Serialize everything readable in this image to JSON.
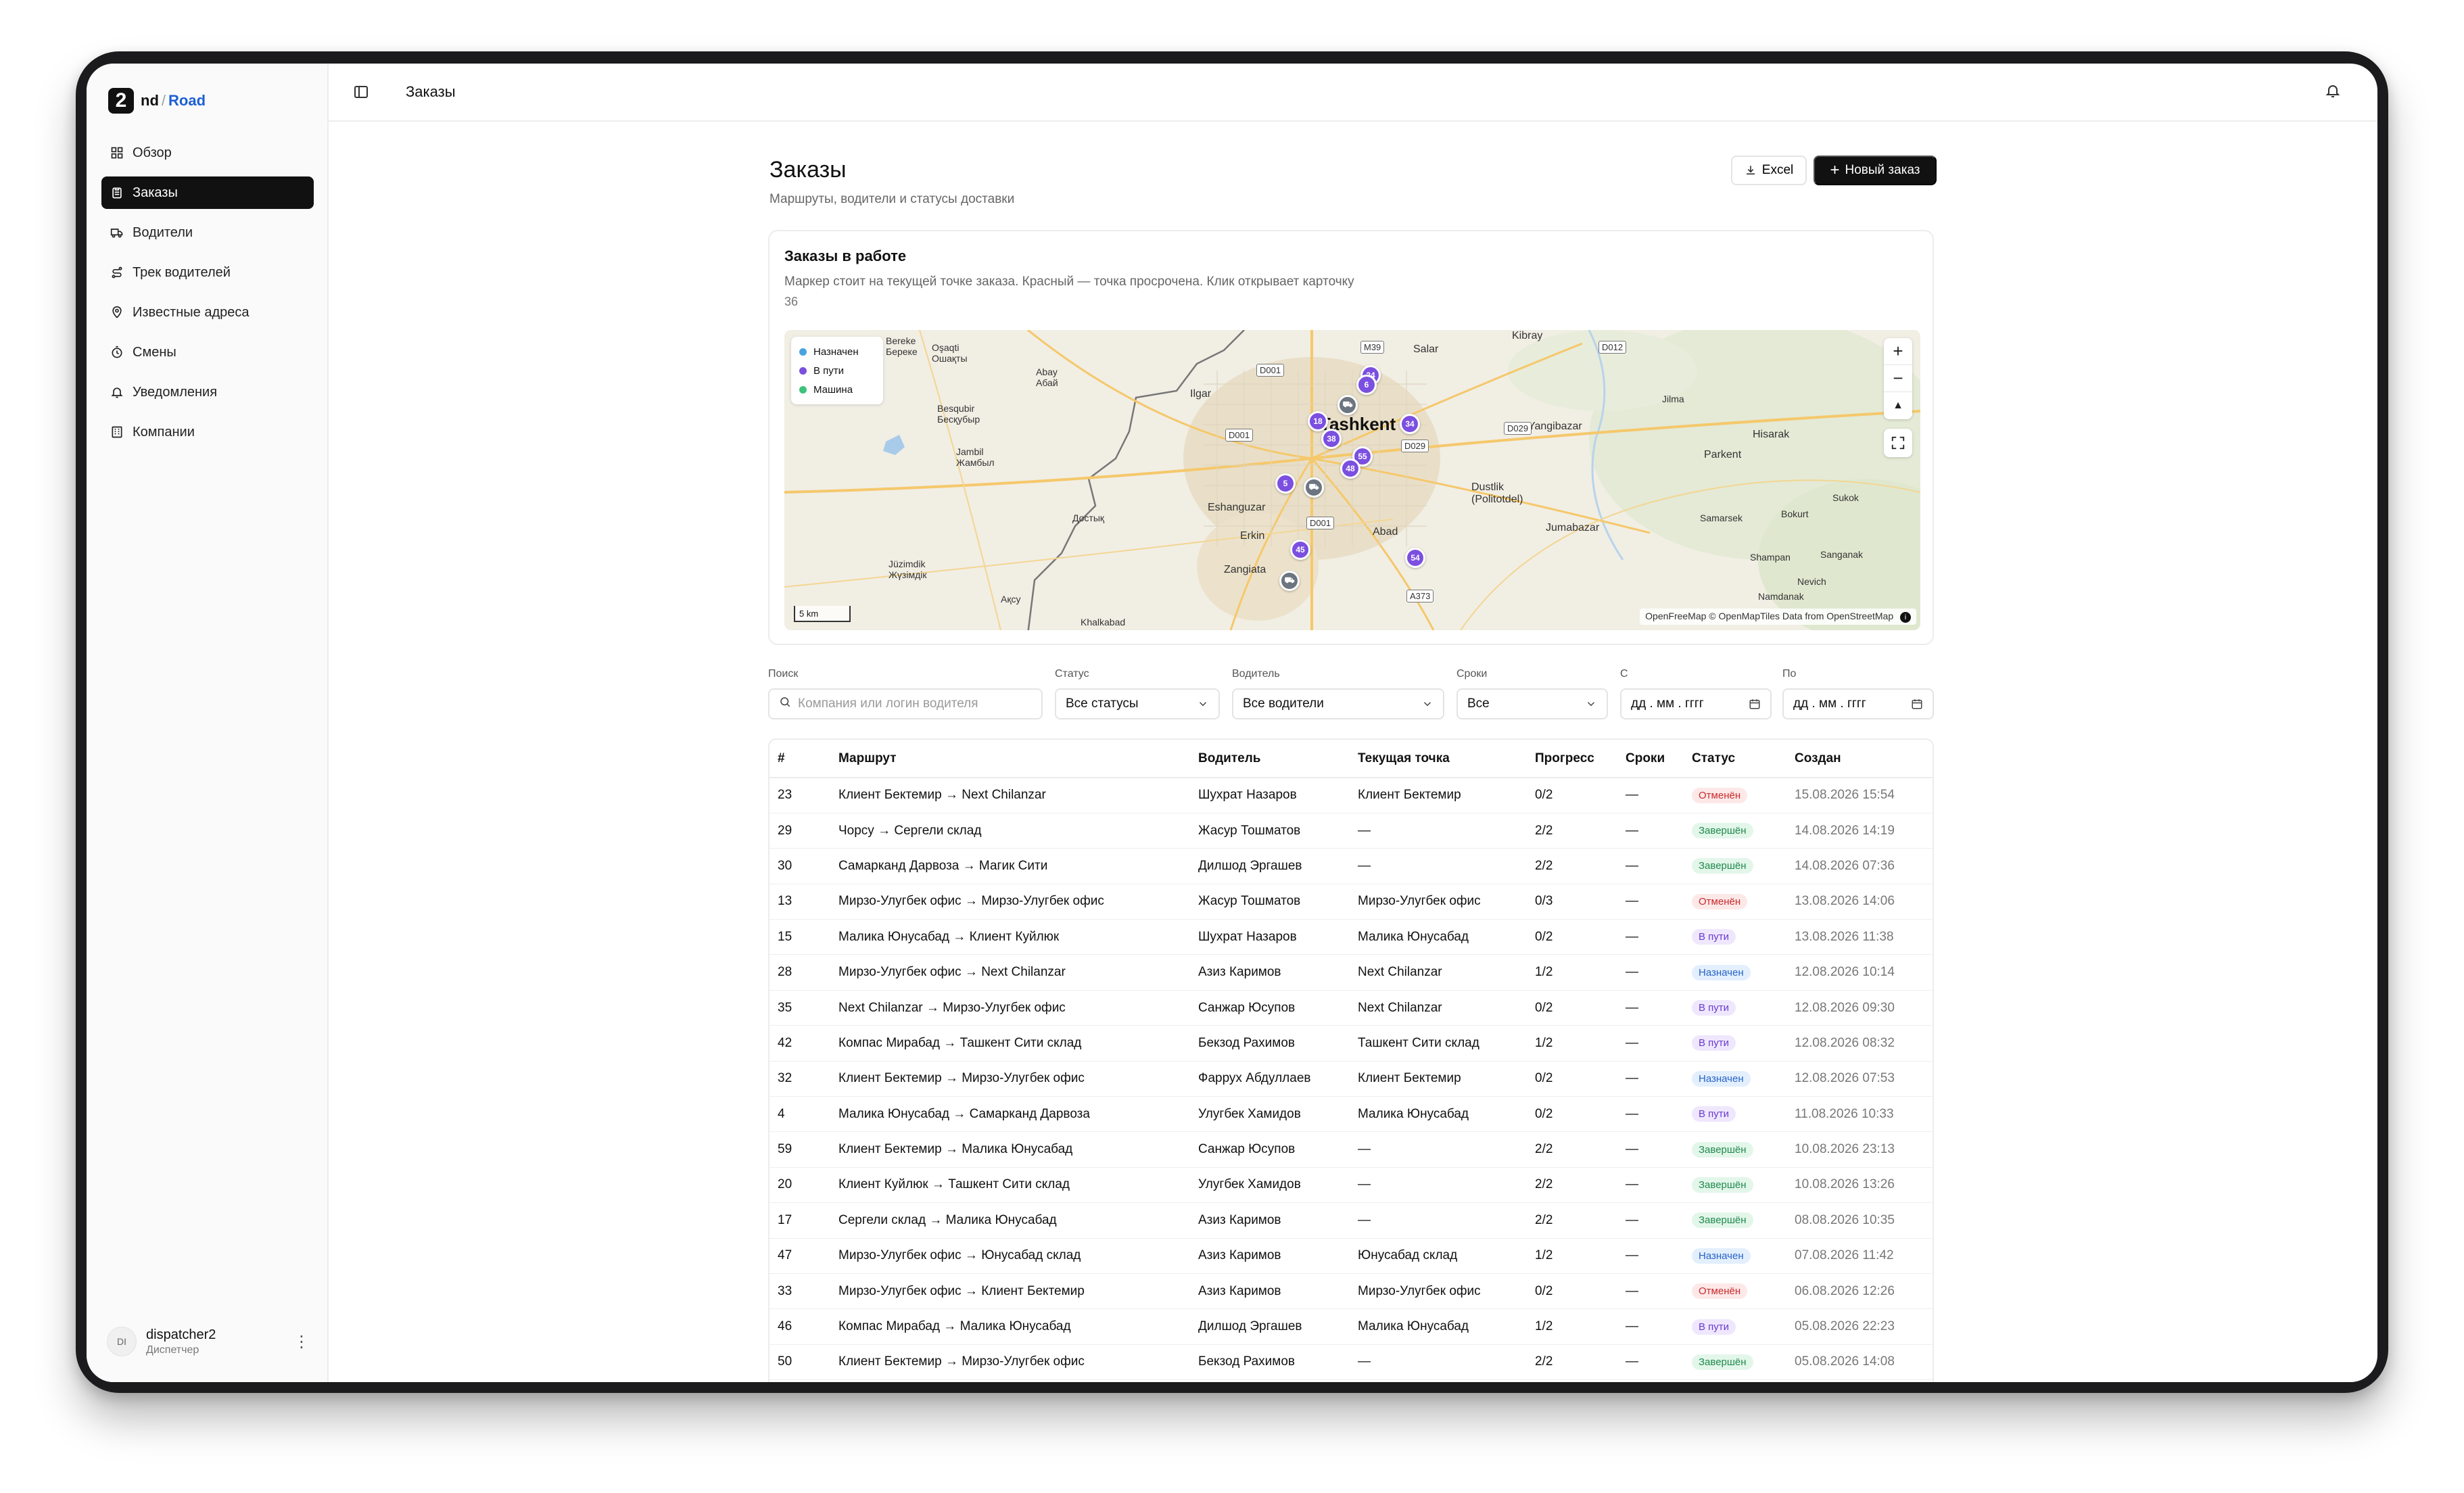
{
  "app": {
    "logo_mark": "2",
    "logo_nd": "nd",
    "logo_slash": "/",
    "logo_road": "Road"
  },
  "sidebar": {
    "items": [
      {
        "label": "Обзор",
        "icon": "grid-icon"
      },
      {
        "label": "Заказы",
        "icon": "clipboard-icon",
        "active": true
      },
      {
        "label": "Водители",
        "icon": "truck-icon"
      },
      {
        "label": "Трек водителей",
        "icon": "route-icon"
      },
      {
        "label": "Известные адреса",
        "icon": "pin-icon"
      },
      {
        "label": "Смены",
        "icon": "clock-icon"
      },
      {
        "label": "Уведомления",
        "icon": "bell-icon"
      },
      {
        "label": "Компании",
        "icon": "building-icon"
      }
    ],
    "user": {
      "initials": "DI",
      "name": "dispatcher2",
      "role": "Диспетчер",
      "menu": "⋮"
    }
  },
  "topbar": {
    "title": "Заказы"
  },
  "page": {
    "title": "Заказы",
    "subtitle": "Маршруты, водители и статусы доставки",
    "excel_label": "Excel",
    "new_label": "Новый заказ"
  },
  "map": {
    "title": "Заказы в работе",
    "description": "Маркер стоит на текущей точке заказа. Красный — точка просрочена. Клик открывает карточку",
    "count": "36",
    "legend": [
      {
        "label": "Назначен",
        "color": "#4aa3df"
      },
      {
        "label": "В пути",
        "color": "#7b4fe0"
      },
      {
        "label": "Машина",
        "color": "#3cc27a"
      }
    ],
    "controls": {
      "zoom_in": "+",
      "zoom_out": "−",
      "compass": "▲"
    },
    "scale": "5 km",
    "attribution": "OpenFreeMap © OpenMapTiles Data from OpenStreetMap",
    "labels": {
      "tashkent": "Tashkent",
      "bereke": "Bereke\nБереке",
      "oshaqti": "Oşaqti\nОшақты",
      "abay": "Abay\nАбай",
      "ilgar": "Ilgar",
      "salar": "Salar",
      "kibray": "Kibray",
      "jilma": "Jilma",
      "hisarak": "Hisarak",
      "parkent": "Parkent",
      "yangibazar": "Yangibazar",
      "dustlik": "Dustlik\n(Politotdel)",
      "jumabazar": "Jumabazar",
      "samarsek": "Samarsek",
      "bokurt": "Bokurt",
      "sukok": "Sukok",
      "shampan": "Shampan",
      "sanganak": "Sanganak",
      "nevich": "Nevich",
      "namdanak": "Namdanak",
      "besqubir": "Besqubir\nБесқубыр",
      "jambil": "Jambil\nЖамбыл",
      "dostyk": "Достық",
      "eshanguzar": "Eshanguzar",
      "erkin": "Erkin",
      "abad": "Abad",
      "zangiata": "Zangiata",
      "juzimdik": "Jüzimdik\nЖүзімдік",
      "aksu": "Ақсу",
      "khalkabad": "Khalkabad",
      "r_m39": "M39",
      "r_d001a": "D001",
      "r_d001b": "D001",
      "r_d001c": "D001",
      "r_d012": "D012",
      "r_d029a": "D029",
      "r_d029b": "D029",
      "r_a373": "A373"
    },
    "markers": [
      {
        "label": "24"
      },
      {
        "label": "6"
      },
      {
        "label": "18"
      },
      {
        "label": "38"
      },
      {
        "label": "34"
      },
      {
        "label": "55"
      },
      {
        "label": "48"
      },
      {
        "label": "5"
      },
      {
        "label": "45"
      },
      {
        "label": "54"
      }
    ]
  },
  "filters": {
    "search_label": "Поиск",
    "search_placeholder": "Компания или логин водителя",
    "status_label": "Статус",
    "status_value": "Все статусы",
    "driver_label": "Водитель",
    "driver_value": "Все водители",
    "deadline_label": "Сроки",
    "deadline_value": "Все",
    "from_label": "С",
    "from_value": "дд . мм . гггг",
    "to_label": "По",
    "to_value": "дд . мм . гггг"
  },
  "table": {
    "headers": [
      "#",
      "Маршрут",
      "Водитель",
      "Текущая точка",
      "Прогресс",
      "Сроки",
      "Статус",
      "Создан"
    ],
    "rows": [
      {
        "id": "23",
        "route": "Клиент Бектемир → Next Chilanzar",
        "driver": "Шухрат Назаров",
        "point": "Клиент Бектемир",
        "progress": "0/2",
        "deadline": "—",
        "status": "Отменён",
        "kind": "cancel",
        "created": "15.08.2026 15:54"
      },
      {
        "id": "29",
        "route": "Чорсу → Сергели склад",
        "driver": "Жасур Тошматов",
        "point": "—",
        "progress": "2/2",
        "deadline": "—",
        "status": "Завершён",
        "kind": "done",
        "created": "14.08.2026 14:19"
      },
      {
        "id": "30",
        "route": "Самарканд Дарвоза → Магик Сити",
        "driver": "Дилшод Эргашев",
        "point": "—",
        "progress": "2/2",
        "deadline": "—",
        "status": "Завершён",
        "kind": "done",
        "created": "14.08.2026 07:36"
      },
      {
        "id": "13",
        "route": "Мирзо-Улугбек офис → Мирзо-Улугбек офис",
        "driver": "Жасур Тошматов",
        "point": "Мирзо-Улугбек офис",
        "progress": "0/3",
        "deadline": "—",
        "status": "Отменён",
        "kind": "cancel",
        "created": "13.08.2026 14:06"
      },
      {
        "id": "15",
        "route": "Малика Юнусабад → Клиент Куйлюк",
        "driver": "Шухрат Назаров",
        "point": "Малика Юнусабад",
        "progress": "0/2",
        "deadline": "—",
        "status": "В пути",
        "kind": "transit",
        "created": "13.08.2026 11:38"
      },
      {
        "id": "28",
        "route": "Мирзо-Улугбек офис → Next Chilanzar",
        "driver": "Азиз Каримов",
        "point": "Next Chilanzar",
        "progress": "1/2",
        "deadline": "—",
        "status": "Назначен",
        "kind": "assigned",
        "created": "12.08.2026 10:14"
      },
      {
        "id": "35",
        "route": "Next Chilanzar → Мирзо-Улугбек офис",
        "driver": "Санжар Юсупов",
        "point": "Next Chilanzar",
        "progress": "0/2",
        "deadline": "—",
        "status": "В пути",
        "kind": "transit",
        "created": "12.08.2026 09:30"
      },
      {
        "id": "42",
        "route": "Компас Мирабад → Ташкент Сити склад",
        "driver": "Бекзод Рахимов",
        "point": "Ташкент Сити склад",
        "progress": "1/2",
        "deadline": "—",
        "status": "В пути",
        "kind": "transit",
        "created": "12.08.2026 08:32"
      },
      {
        "id": "32",
        "route": "Клиент Бектемир → Мирзо-Улугбек офис",
        "driver": "Фаррух Абдуллаев",
        "point": "Клиент Бектемир",
        "progress": "0/2",
        "deadline": "—",
        "status": "Назначен",
        "kind": "assigned",
        "created": "12.08.2026 07:53"
      },
      {
        "id": "4",
        "route": "Малика Юнусабад → Самарканд Дарвоза",
        "driver": "Улугбек Хамидов",
        "point": "Малика Юнусабад",
        "progress": "0/2",
        "deadline": "—",
        "status": "В пути",
        "kind": "transit",
        "created": "11.08.2026 10:33"
      },
      {
        "id": "59",
        "route": "Клиент Бектемир → Малика Юнусабад",
        "driver": "Санжар Юсупов",
        "point": "—",
        "progress": "2/2",
        "deadline": "—",
        "status": "Завершён",
        "kind": "done",
        "created": "10.08.2026 23:13"
      },
      {
        "id": "20",
        "route": "Клиент Куйлюк → Ташкент Сити склад",
        "driver": "Улугбек Хамидов",
        "point": "—",
        "progress": "2/2",
        "deadline": "—",
        "status": "Завершён",
        "kind": "done",
        "created": "10.08.2026 13:26"
      },
      {
        "id": "17",
        "route": "Сергели склад → Малика Юнусабад",
        "driver": "Азиз Каримов",
        "point": "—",
        "progress": "2/2",
        "deadline": "—",
        "status": "Завершён",
        "kind": "done",
        "created": "08.08.2026 10:35"
      },
      {
        "id": "47",
        "route": "Мирзо-Улугбек офис → Юнусабад склад",
        "driver": "Азиз Каримов",
        "point": "Юнусабад склад",
        "progress": "1/2",
        "deadline": "—",
        "status": "Назначен",
        "kind": "assigned",
        "created": "07.08.2026 11:42"
      },
      {
        "id": "33",
        "route": "Мирзо-Улугбек офис → Клиент Бектемир",
        "driver": "Азиз Каримов",
        "point": "Мирзо-Улугбек офис",
        "progress": "0/2",
        "deadline": "—",
        "status": "Отменён",
        "kind": "cancel",
        "created": "06.08.2026 12:26"
      },
      {
        "id": "46",
        "route": "Компас Мирабад → Малика Юнусабад",
        "driver": "Дилшод Эргашев",
        "point": "Малика Юнусабад",
        "progress": "1/2",
        "deadline": "—",
        "status": "В пути",
        "kind": "transit",
        "created": "05.08.2026 22:23"
      },
      {
        "id": "50",
        "route": "Клиент Бектемир → Мирзо-Улугбек офис",
        "driver": "Бекзод Рахимов",
        "point": "—",
        "progress": "2/2",
        "deadline": "—",
        "status": "Завершён",
        "kind": "done",
        "created": "05.08.2026 14:08"
      }
    ]
  }
}
